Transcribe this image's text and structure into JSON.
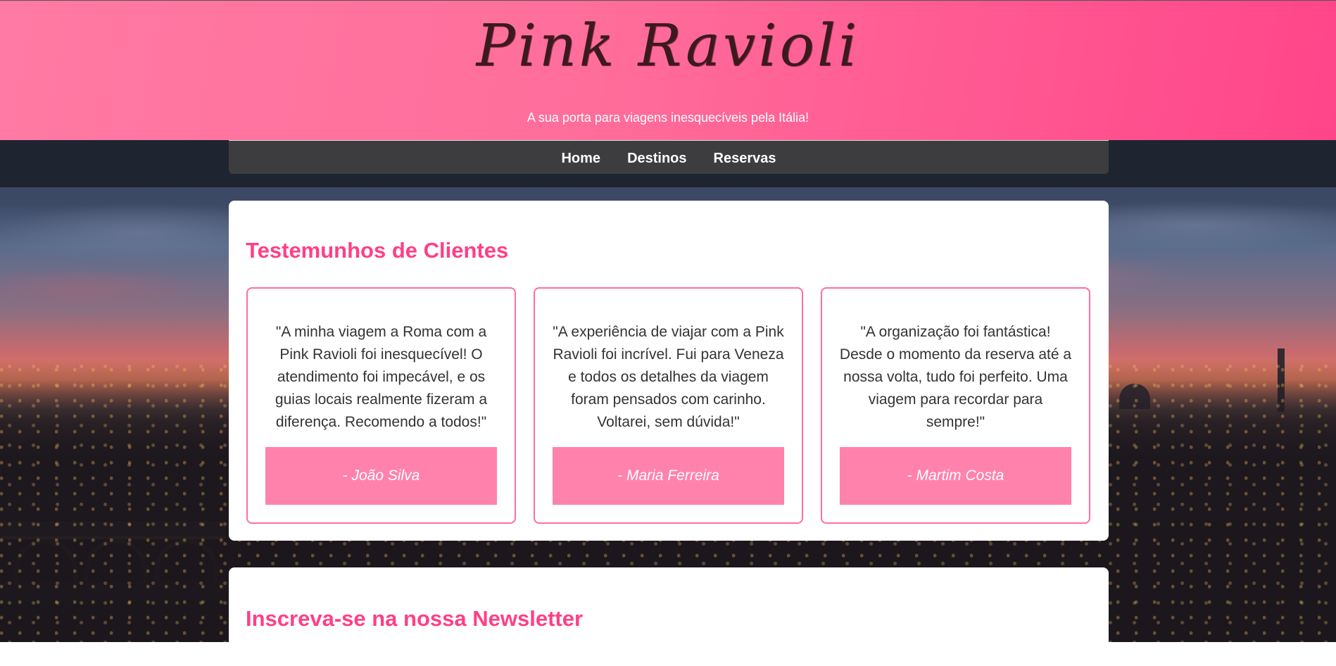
{
  "header": {
    "brand": "Pink Ravioli",
    "tagline": "A sua porta para viagens inesquecíveis pela Itália!"
  },
  "nav": {
    "items": [
      {
        "label": "Home"
      },
      {
        "label": "Destinos"
      },
      {
        "label": "Reservas"
      }
    ]
  },
  "testimonials": {
    "title": "Testemunhos de Clientes",
    "items": [
      {
        "quote": "\"A minha viagem a Roma com a Pink Ravioli foi inesquecível! O atendimento foi impecável, e os guias locais realmente fizeram a diferença. Recomendo a todos!\"",
        "author": "- João Silva"
      },
      {
        "quote": "\"A experiência de viajar com a Pink Ravioli foi incrível. Fui para Veneza e todos os detalhes da viagem foram pensados com carinho. Voltarei, sem dúvida!\"",
        "author": "- Maria Ferreira"
      },
      {
        "quote": "\"A organização foi fantástica! Desde o momento da reserva até a nossa volta, tudo foi perfeito. Uma viagem para recordar para sempre!\"",
        "author": "- Martim Costa"
      }
    ]
  },
  "newsletter": {
    "title": "Inscreva-se na nossa Newsletter"
  },
  "colors": {
    "accent": "#ff3f86",
    "header_gradient_start": "#ff7aa4",
    "header_gradient_end": "#ff4589",
    "nav_background": "#3d3d3f",
    "author_box": "#ff82ad",
    "card_border": "#ff6ea3"
  }
}
